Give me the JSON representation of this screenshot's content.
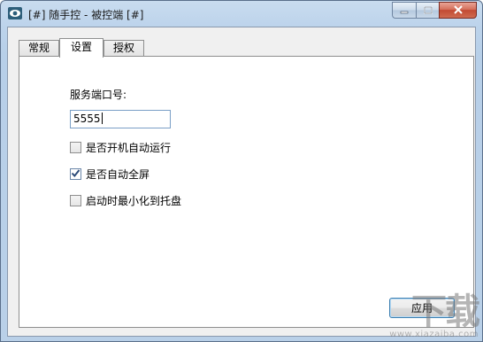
{
  "window": {
    "title": "[#] 随手控 - 被控端 [#]",
    "controls": {
      "minimize": "minimize-icon",
      "maximize": "maximize-icon",
      "close": "close-icon"
    }
  },
  "tabs": [
    {
      "label": "常规",
      "active": false
    },
    {
      "label": "设置",
      "active": true
    },
    {
      "label": "授权",
      "active": false
    }
  ],
  "settings": {
    "port_label": "服务端口号:",
    "port_value": "5555",
    "options": [
      {
        "label": "是否开机自动运行",
        "checked": false
      },
      {
        "label": "是否自动全屏",
        "checked": true
      },
      {
        "label": "启动时最小化到托盘",
        "checked": false
      }
    ],
    "apply_label": "应用"
  },
  "watermark": {
    "logo_text": "下载",
    "url_text": "www.xiazaiba.com"
  }
}
